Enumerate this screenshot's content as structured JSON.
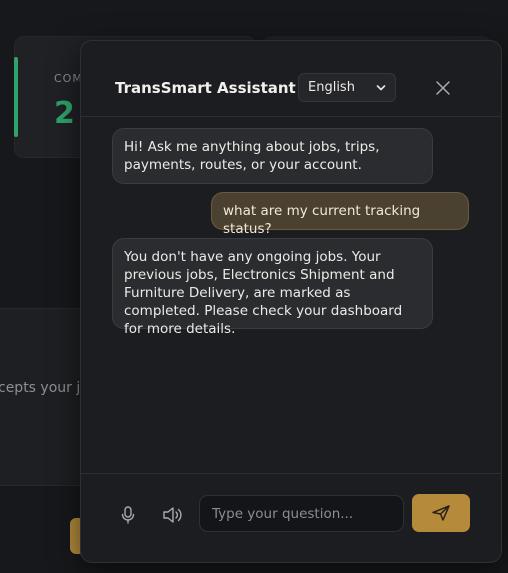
{
  "background": {
    "stat_label": "COM",
    "stat_value": "2",
    "panel_text": "cepts your jo"
  },
  "assistant": {
    "title": "TransSmart Assistant",
    "language": "English",
    "messages": [
      {
        "role": "bot",
        "text": "Hi! Ask me anything about jobs, trips, payments, routes, or your account."
      },
      {
        "role": "user",
        "text": "what are my current tracking status?"
      },
      {
        "role": "bot",
        "text": "You don't have any ongoing jobs. Your previous jobs, Electronics Shipment and Furniture Delivery, are marked as completed. Please check your dashboard for more details."
      }
    ],
    "input_placeholder": "Type your question...",
    "icons": {
      "close": "close-icon",
      "language_dropdown": "chevron-down-icon",
      "mic": "microphone-icon",
      "speaker": "speaker-icon",
      "send": "send-icon"
    }
  },
  "colors": {
    "accent_green": "#2fa36b",
    "accent_gold": "#b58b3b",
    "user_bubble": "#4b4130"
  }
}
